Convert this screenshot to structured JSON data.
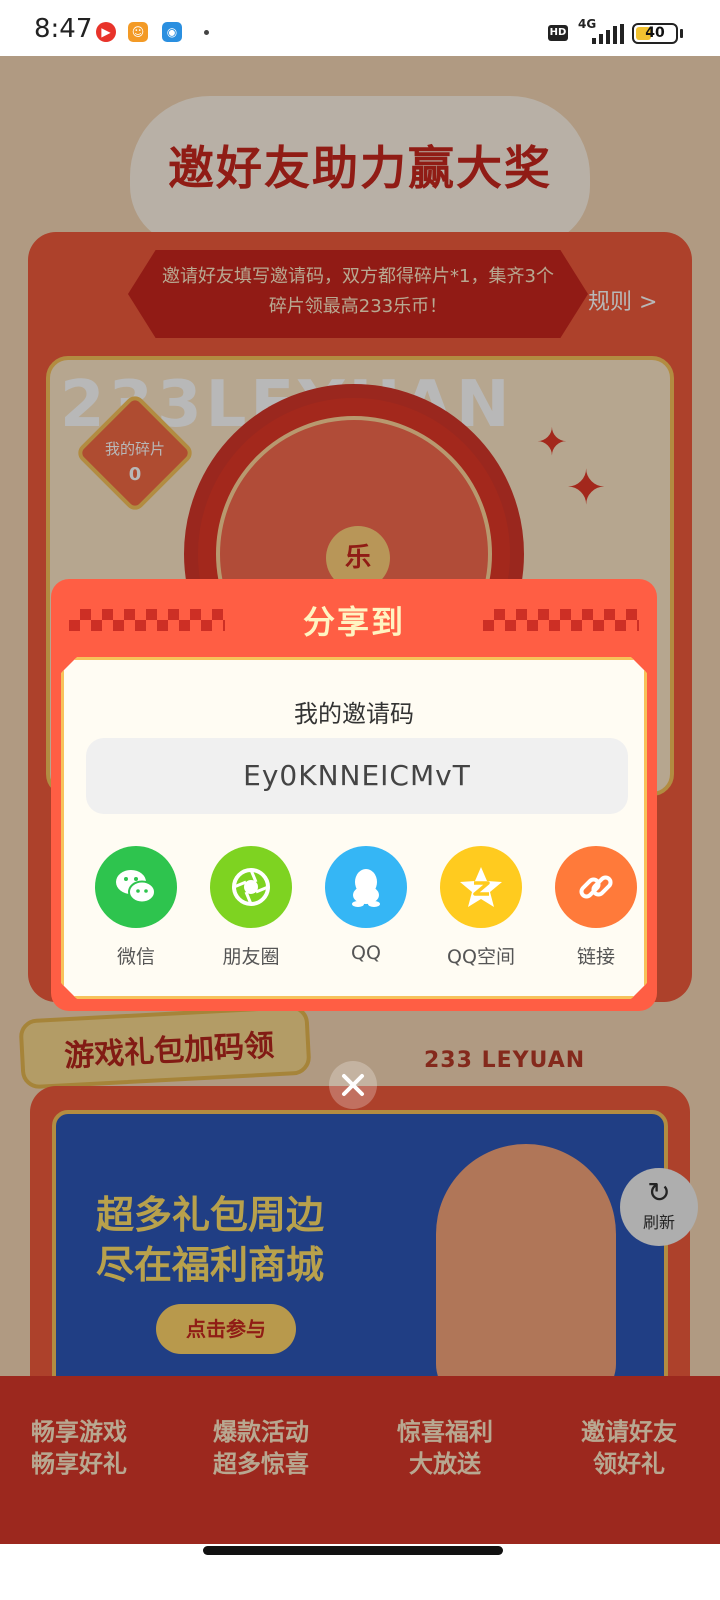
{
  "status_bar": {
    "time": "8:47",
    "network": "4G",
    "hd": "HD",
    "battery": "40",
    "battery_level": 0.4
  },
  "page": {
    "hero_title": "邀好友助力赢大奖",
    "rule_text": "邀请好友填写邀请码，双方都得碎片*1，集齐3个碎片领最高233乐币！",
    "rule_link": "规则 >",
    "watermark": "233LEYUAN",
    "my_shards_label": "我的碎片",
    "my_shards_value": "0",
    "wheel_center": "乐",
    "gift_section_title": "游戏礼包加码领",
    "leyuan_label": "233 LEYUAN",
    "banner_line1": "超多礼包周边",
    "banner_line2": "尽在福利商城",
    "banner_cta": "点击参与",
    "refresh_label": "刷新",
    "bottom_tabs": [
      {
        "line1": "畅享游戏",
        "line2": "畅享好礼"
      },
      {
        "line1": "爆款活动",
        "line2": "超多惊喜"
      },
      {
        "line1": "惊喜福利",
        "line2": "大放送"
      },
      {
        "line1": "邀请好友",
        "line2": "领好礼"
      }
    ]
  },
  "modal": {
    "title": "分享到",
    "code_label": "我的邀请码",
    "code_value": "Ey0KNNEICMvT",
    "share_options": [
      {
        "label": "微信",
        "icon": "wechat-icon",
        "color": "#2ec44e"
      },
      {
        "label": "朋友圈",
        "icon": "moments-icon",
        "color": "#7ed321"
      },
      {
        "label": "QQ",
        "icon": "qq-icon",
        "color": "#35b6f5"
      },
      {
        "label": "QQ空间",
        "icon": "qzone-icon",
        "color": "#ffcb1f"
      },
      {
        "label": "链接",
        "icon": "link-icon",
        "color": "#ff7a3a"
      }
    ]
  },
  "colors": {
    "modal_frame": "#ff5e44",
    "modal_body": "#fffcf3",
    "accent_gold": "#f7c25a",
    "page_red": "#f05a3c"
  }
}
